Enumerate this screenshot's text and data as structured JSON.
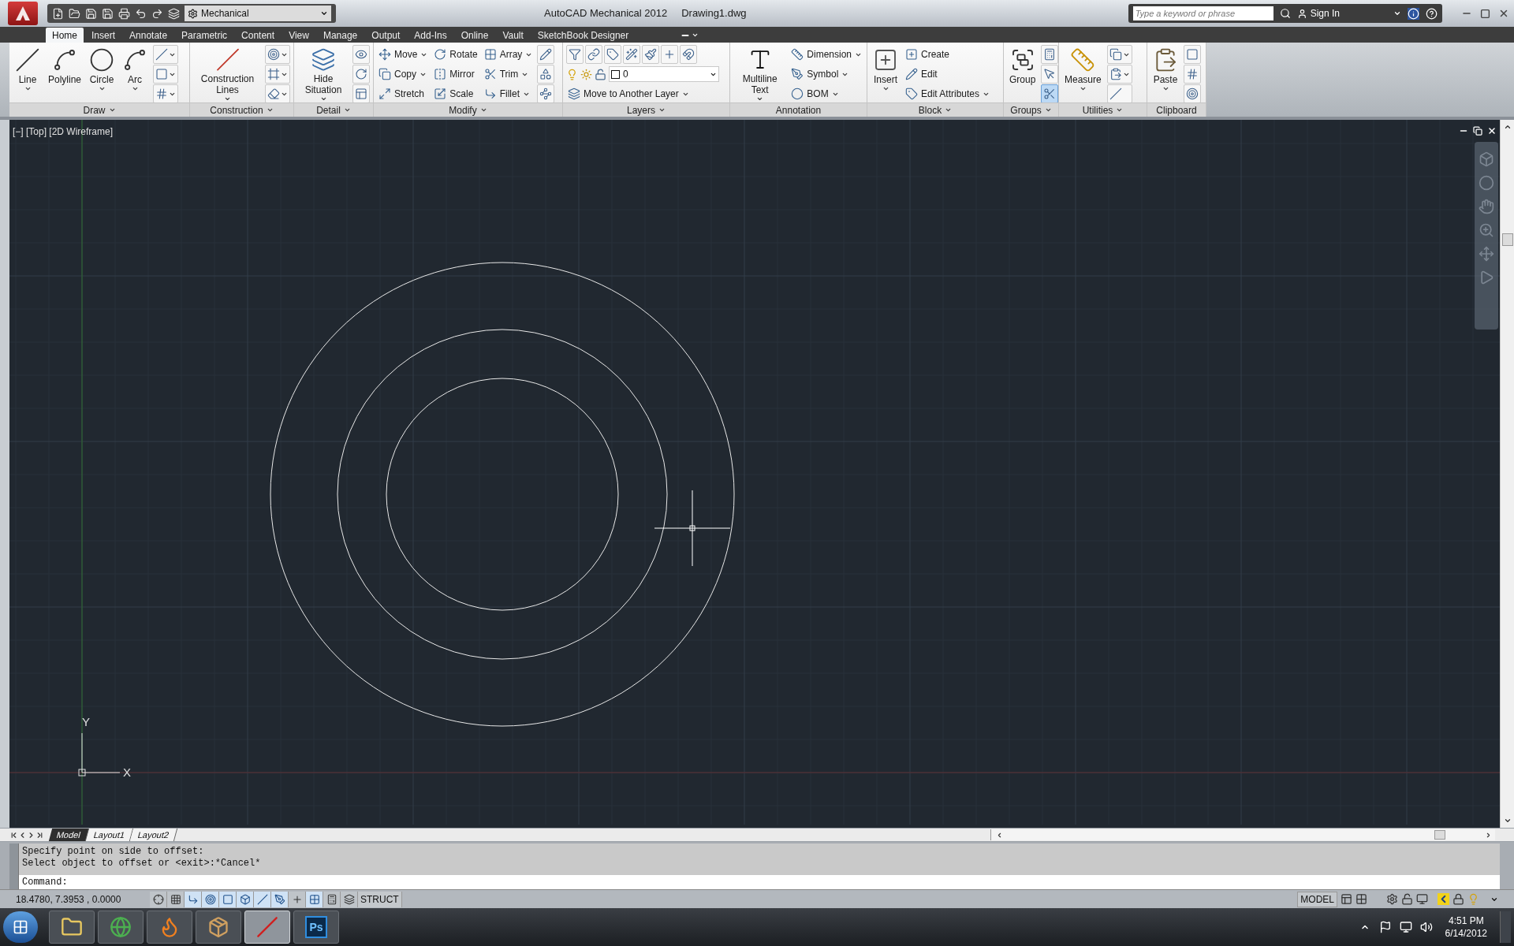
{
  "title_bar": {
    "workspace": "Mechanical",
    "app_title": "AutoCAD Mechanical 2012",
    "document": "Drawing1.dwg",
    "search_placeholder": "Type a keyword or phrase",
    "sign_in": "Sign In"
  },
  "ribbon_tabs": [
    {
      "label": "Home",
      "selected": true
    },
    {
      "label": "Insert",
      "selected": false
    },
    {
      "label": "Annotate",
      "selected": false
    },
    {
      "label": "Parametric",
      "selected": false
    },
    {
      "label": "Content",
      "selected": false
    },
    {
      "label": "View",
      "selected": false
    },
    {
      "label": "Manage",
      "selected": false
    },
    {
      "label": "Output",
      "selected": false
    },
    {
      "label": "Add-Ins",
      "selected": false
    },
    {
      "label": "Online",
      "selected": false
    },
    {
      "label": "Vault",
      "selected": false
    },
    {
      "label": "SketchBook Designer",
      "selected": false
    }
  ],
  "ribbon_panels": [
    {
      "title": "Draw",
      "menu": true,
      "kind": "tools",
      "tools": [
        {
          "kind": "large",
          "label": "Line",
          "menu": true
        },
        {
          "kind": "large",
          "label": "Polyline",
          "menu": false
        },
        {
          "kind": "large",
          "label": "Circle",
          "menu": true
        },
        {
          "kind": "large",
          "label": "Arc",
          "menu": true
        },
        {
          "kind": "icon",
          "menu": true
        },
        {
          "kind": "icon",
          "menu": true
        },
        {
          "kind": "icon",
          "menu": true
        }
      ]
    },
    {
      "title": "Construction",
      "menu": true,
      "kind": "tools",
      "tools": [
        {
          "kind": "large",
          "label": "Construction Lines",
          "menu": true
        },
        {
          "kind": "icon",
          "menu": true
        },
        {
          "kind": "icon",
          "menu": true
        },
        {
          "kind": "icon",
          "menu": true
        }
      ]
    },
    {
      "title": "Detail",
      "menu": true,
      "kind": "tools",
      "tools": [
        {
          "kind": "large",
          "label": "Hide Situation",
          "menu": true
        },
        {
          "kind": "icon",
          "menu": false
        },
        {
          "kind": "icon",
          "menu": false
        },
        {
          "kind": "icon",
          "menu": false
        }
      ]
    },
    {
      "title": "Modify",
      "menu": true,
      "kind": "tools",
      "tools": [
        {
          "kind": "small",
          "label": "Move",
          "menu": true
        },
        {
          "kind": "small",
          "label": "Copy",
          "menu": true
        },
        {
          "kind": "small",
          "label": "Stretch",
          "menu": false
        },
        {
          "kind": "small",
          "label": "Rotate",
          "menu": false
        },
        {
          "kind": "small",
          "label": "Mirror",
          "menu": false
        },
        {
          "kind": "small",
          "label": "Scale",
          "menu": false
        },
        {
          "kind": "small",
          "label": "Array",
          "menu": true
        },
        {
          "kind": "small",
          "label": "Trim",
          "menu": true
        },
        {
          "kind": "small",
          "label": "Fillet",
          "menu": true
        },
        {
          "kind": "icon",
          "menu": false
        },
        {
          "kind": "icon",
          "menu": false
        },
        {
          "kind": "icon",
          "menu": false
        }
      ]
    },
    {
      "title": "Layers",
      "menu": true,
      "kind": "layers",
      "tools": [
        {
          "kind": "icon",
          "menu": false
        },
        {
          "kind": "icon",
          "menu": false
        },
        {
          "kind": "icon",
          "menu": false
        },
        {
          "kind": "icon",
          "menu": false
        },
        {
          "kind": "icon",
          "menu": false
        },
        {
          "kind": "icon",
          "menu": false
        },
        {
          "kind": "icon",
          "menu": false
        },
        {
          "kind": "layer_select",
          "value": "0"
        },
        {
          "kind": "small",
          "label": "Move to Another Layer",
          "menu": true
        }
      ]
    },
    {
      "title": "Annotation",
      "menu": false,
      "kind": "tools",
      "tools": [
        {
          "kind": "large",
          "label": "Multiline Text",
          "menu": true
        },
        {
          "kind": "small",
          "label": "Dimension",
          "menu": true
        },
        {
          "kind": "small",
          "label": "Symbol",
          "menu": true
        },
        {
          "kind": "small",
          "label": "BOM",
          "menu": true
        }
      ]
    },
    {
      "title": "Block",
      "menu": true,
      "kind": "tools",
      "tools": [
        {
          "kind": "large",
          "label": "Insert",
          "menu": true
        },
        {
          "kind": "small",
          "label": "Create",
          "menu": false
        },
        {
          "kind": "small",
          "label": "Edit",
          "menu": false
        },
        {
          "kind": "small",
          "label": "Edit Attributes",
          "menu": true
        }
      ]
    },
    {
      "title": "Groups",
      "menu": true,
      "kind": "tools",
      "tools": [
        {
          "kind": "large",
          "label": "Group",
          "menu": false,
          "on": false
        },
        {
          "kind": "icon",
          "menu": false,
          "on": false
        },
        {
          "kind": "icon",
          "menu": false,
          "on": false
        },
        {
          "kind": "icon",
          "menu": false,
          "on": true
        }
      ]
    },
    {
      "title": "Utilities",
      "menu": true,
      "kind": "tools",
      "tools": [
        {
          "kind": "large",
          "label": "Measure",
          "menu": true
        },
        {
          "kind": "icon",
          "menu": true
        },
        {
          "kind": "icon",
          "menu": true
        },
        {
          "kind": "icon",
          "menu": false
        }
      ]
    },
    {
      "title": "Clipboard",
      "menu": false,
      "kind": "tools",
      "tools": [
        {
          "kind": "large",
          "label": "Paste",
          "menu": true
        },
        {
          "kind": "icon",
          "menu": false
        },
        {
          "kind": "icon",
          "menu": false
        },
        {
          "kind": "icon",
          "menu": false
        }
      ]
    }
  ],
  "viewport": {
    "label": "[−] [Top] [2D Wireframe]",
    "ucs": {
      "x_label": "X",
      "y_label": "Y"
    }
  },
  "layout_tabs": [
    {
      "label": "Model",
      "selected": true
    },
    {
      "label": "Layout1",
      "selected": false
    },
    {
      "label": "Layout2",
      "selected": false
    }
  ],
  "command_line": {
    "history": [
      "Specify point on side to offset:",
      "Select object to offset or <exit>:*Cancel*"
    ],
    "prompt": "Command:"
  },
  "status_bar": {
    "coordinates": "18.4780, 7.3953 , 0.0000",
    "toggles": [
      {
        "on": false
      },
      {
        "on": false
      },
      {
        "on": true
      },
      {
        "on": true
      },
      {
        "on": true
      },
      {
        "on": true
      },
      {
        "on": true
      },
      {
        "on": true
      },
      {
        "on": false
      },
      {
        "on": true
      },
      {
        "on": false
      },
      {
        "on": false
      }
    ],
    "struct": "STRUCT",
    "space": "MODEL"
  },
  "taskbar": {
    "apps": [
      {
        "selected": false
      },
      {
        "selected": false
      },
      {
        "selected": false
      },
      {
        "selected": false
      },
      {
        "selected": true
      },
      {
        "selected": false,
        "label": "Ps"
      }
    ],
    "time": "4:51 PM",
    "date": "6/14/2012"
  }
}
